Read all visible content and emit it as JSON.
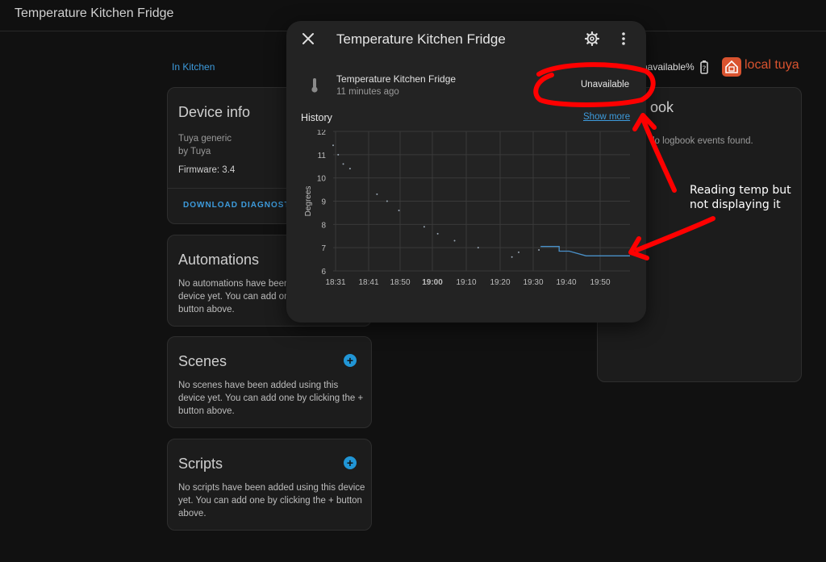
{
  "topbar": {
    "title": "Temperature Kitchen Fridge"
  },
  "area_link": "In Kitchen",
  "device_info": {
    "title": "Device info",
    "model": "Tuya generic",
    "manufacturer": "by Tuya",
    "firmware": "Firmware: 3.4",
    "download_label": "DOWNLOAD DIAGNOSTIC"
  },
  "automations": {
    "title": "Automations",
    "desc": [
      "No automations have been",
      "device yet. You can add on",
      "button above."
    ]
  },
  "scenes": {
    "title": "Scenes",
    "desc": [
      "No scenes have been added using this",
      "device yet. You can add one by clicking the +",
      "button above."
    ]
  },
  "scripts": {
    "title": "Scripts",
    "desc": [
      "No scripts have been added using this device",
      "yet. You can add one by clicking the + button",
      "above."
    ]
  },
  "logbook": {
    "title": "ook",
    "empty": "lo logbook events found."
  },
  "header_status": {
    "unavailable": "navailable%",
    "integration_text": "local tuya"
  },
  "dialog": {
    "title": "Temperature Kitchen Fridge",
    "entity_name": "Temperature Kitchen Fridge",
    "last_changed": "11 minutes ago",
    "state": "Unavailable",
    "history_label": "History",
    "show_more": "Show more"
  },
  "annotation": {
    "line1": "Reading temp but",
    "line2": "not displaying it"
  },
  "colors": {
    "accent": "#3d9bdc",
    "annotation": "#ff0000",
    "series": "#4a90c8"
  },
  "chart_data": {
    "type": "line",
    "ylabel": "Degrees",
    "ylim": [
      6,
      12
    ],
    "yticks": [
      6,
      7,
      8,
      9,
      10,
      11,
      12
    ],
    "xticks": [
      "18:31",
      "18:41",
      "18:50",
      "19:00",
      "19:10",
      "19:20",
      "19:30",
      "19:40",
      "19:50"
    ],
    "xrange_minutes": [
      0,
      88
    ],
    "grid": true,
    "series": [
      {
        "points": [
          [
            0,
            11.4
          ],
          [
            1.5,
            11.0
          ],
          [
            3,
            10.6
          ],
          [
            5,
            10.4
          ],
          [
            13,
            9.3
          ],
          [
            16,
            9.0
          ],
          [
            19.5,
            8.6
          ],
          [
            27,
            7.9
          ],
          [
            31,
            7.6
          ],
          [
            36,
            7.3
          ],
          [
            43,
            7.0
          ],
          [
            53,
            6.6
          ],
          [
            55,
            6.8
          ],
          [
            61,
            6.9
          ]
        ],
        "line": [
          [
            61.5,
            7.05
          ],
          [
            67,
            7.05
          ],
          [
            67,
            6.85
          ],
          [
            70,
            6.85
          ],
          [
            75,
            6.65
          ],
          [
            88,
            6.65
          ]
        ]
      }
    ]
  }
}
